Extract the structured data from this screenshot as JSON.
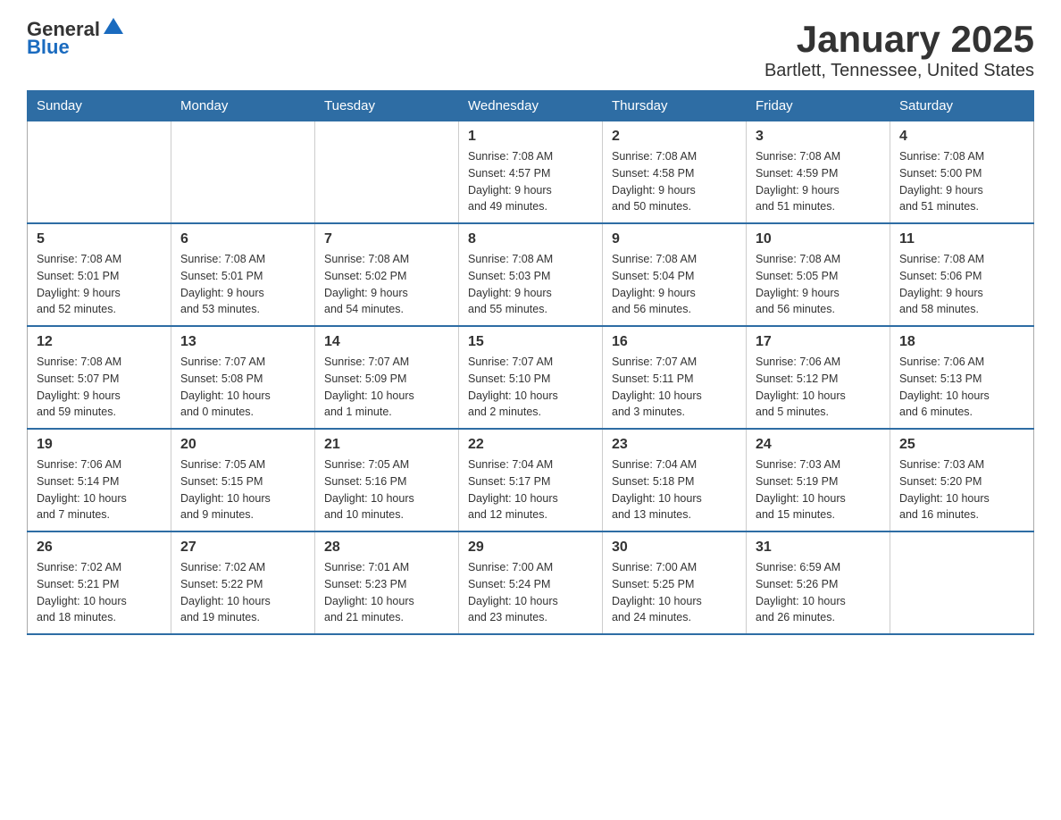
{
  "logo": {
    "general": "General",
    "blue": "Blue"
  },
  "title": "January 2025",
  "subtitle": "Bartlett, Tennessee, United States",
  "days_of_week": [
    "Sunday",
    "Monday",
    "Tuesday",
    "Wednesday",
    "Thursday",
    "Friday",
    "Saturday"
  ],
  "weeks": [
    [
      {
        "day": "",
        "info": ""
      },
      {
        "day": "",
        "info": ""
      },
      {
        "day": "",
        "info": ""
      },
      {
        "day": "1",
        "info": "Sunrise: 7:08 AM\nSunset: 4:57 PM\nDaylight: 9 hours\nand 49 minutes."
      },
      {
        "day": "2",
        "info": "Sunrise: 7:08 AM\nSunset: 4:58 PM\nDaylight: 9 hours\nand 50 minutes."
      },
      {
        "day": "3",
        "info": "Sunrise: 7:08 AM\nSunset: 4:59 PM\nDaylight: 9 hours\nand 51 minutes."
      },
      {
        "day": "4",
        "info": "Sunrise: 7:08 AM\nSunset: 5:00 PM\nDaylight: 9 hours\nand 51 minutes."
      }
    ],
    [
      {
        "day": "5",
        "info": "Sunrise: 7:08 AM\nSunset: 5:01 PM\nDaylight: 9 hours\nand 52 minutes."
      },
      {
        "day": "6",
        "info": "Sunrise: 7:08 AM\nSunset: 5:01 PM\nDaylight: 9 hours\nand 53 minutes."
      },
      {
        "day": "7",
        "info": "Sunrise: 7:08 AM\nSunset: 5:02 PM\nDaylight: 9 hours\nand 54 minutes."
      },
      {
        "day": "8",
        "info": "Sunrise: 7:08 AM\nSunset: 5:03 PM\nDaylight: 9 hours\nand 55 minutes."
      },
      {
        "day": "9",
        "info": "Sunrise: 7:08 AM\nSunset: 5:04 PM\nDaylight: 9 hours\nand 56 minutes."
      },
      {
        "day": "10",
        "info": "Sunrise: 7:08 AM\nSunset: 5:05 PM\nDaylight: 9 hours\nand 56 minutes."
      },
      {
        "day": "11",
        "info": "Sunrise: 7:08 AM\nSunset: 5:06 PM\nDaylight: 9 hours\nand 58 minutes."
      }
    ],
    [
      {
        "day": "12",
        "info": "Sunrise: 7:08 AM\nSunset: 5:07 PM\nDaylight: 9 hours\nand 59 minutes."
      },
      {
        "day": "13",
        "info": "Sunrise: 7:07 AM\nSunset: 5:08 PM\nDaylight: 10 hours\nand 0 minutes."
      },
      {
        "day": "14",
        "info": "Sunrise: 7:07 AM\nSunset: 5:09 PM\nDaylight: 10 hours\nand 1 minute."
      },
      {
        "day": "15",
        "info": "Sunrise: 7:07 AM\nSunset: 5:10 PM\nDaylight: 10 hours\nand 2 minutes."
      },
      {
        "day": "16",
        "info": "Sunrise: 7:07 AM\nSunset: 5:11 PM\nDaylight: 10 hours\nand 3 minutes."
      },
      {
        "day": "17",
        "info": "Sunrise: 7:06 AM\nSunset: 5:12 PM\nDaylight: 10 hours\nand 5 minutes."
      },
      {
        "day": "18",
        "info": "Sunrise: 7:06 AM\nSunset: 5:13 PM\nDaylight: 10 hours\nand 6 minutes."
      }
    ],
    [
      {
        "day": "19",
        "info": "Sunrise: 7:06 AM\nSunset: 5:14 PM\nDaylight: 10 hours\nand 7 minutes."
      },
      {
        "day": "20",
        "info": "Sunrise: 7:05 AM\nSunset: 5:15 PM\nDaylight: 10 hours\nand 9 minutes."
      },
      {
        "day": "21",
        "info": "Sunrise: 7:05 AM\nSunset: 5:16 PM\nDaylight: 10 hours\nand 10 minutes."
      },
      {
        "day": "22",
        "info": "Sunrise: 7:04 AM\nSunset: 5:17 PM\nDaylight: 10 hours\nand 12 minutes."
      },
      {
        "day": "23",
        "info": "Sunrise: 7:04 AM\nSunset: 5:18 PM\nDaylight: 10 hours\nand 13 minutes."
      },
      {
        "day": "24",
        "info": "Sunrise: 7:03 AM\nSunset: 5:19 PM\nDaylight: 10 hours\nand 15 minutes."
      },
      {
        "day": "25",
        "info": "Sunrise: 7:03 AM\nSunset: 5:20 PM\nDaylight: 10 hours\nand 16 minutes."
      }
    ],
    [
      {
        "day": "26",
        "info": "Sunrise: 7:02 AM\nSunset: 5:21 PM\nDaylight: 10 hours\nand 18 minutes."
      },
      {
        "day": "27",
        "info": "Sunrise: 7:02 AM\nSunset: 5:22 PM\nDaylight: 10 hours\nand 19 minutes."
      },
      {
        "day": "28",
        "info": "Sunrise: 7:01 AM\nSunset: 5:23 PM\nDaylight: 10 hours\nand 21 minutes."
      },
      {
        "day": "29",
        "info": "Sunrise: 7:00 AM\nSunset: 5:24 PM\nDaylight: 10 hours\nand 23 minutes."
      },
      {
        "day": "30",
        "info": "Sunrise: 7:00 AM\nSunset: 5:25 PM\nDaylight: 10 hours\nand 24 minutes."
      },
      {
        "day": "31",
        "info": "Sunrise: 6:59 AM\nSunset: 5:26 PM\nDaylight: 10 hours\nand 26 minutes."
      },
      {
        "day": "",
        "info": ""
      }
    ]
  ]
}
